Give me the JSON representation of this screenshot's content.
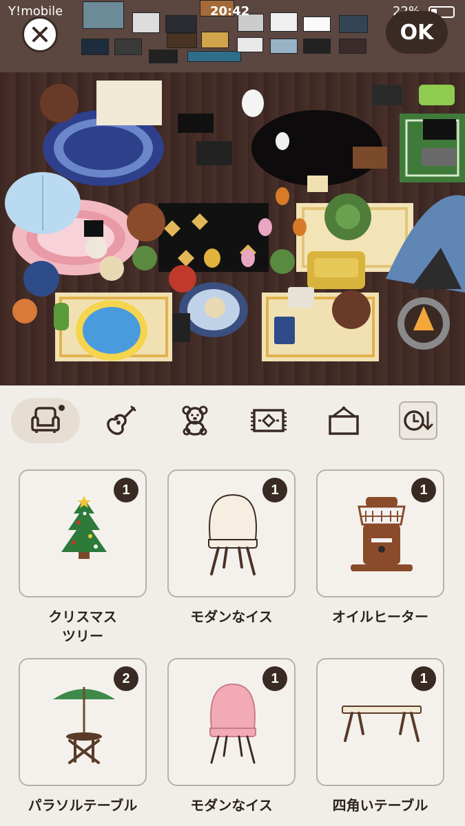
{
  "status_bar": {
    "carrier": "Y!mobile",
    "time": "20:42",
    "battery": "22%"
  },
  "header": {
    "ok_label": "OK"
  },
  "tabs": [
    {
      "name": "furniture",
      "icon": "armchair-icon",
      "active": true,
      "has_dot": true
    },
    {
      "name": "instruments",
      "icon": "guitar-icon"
    },
    {
      "name": "toys",
      "icon": "teddy-bear-icon"
    },
    {
      "name": "rugs",
      "icon": "rug-icon"
    },
    {
      "name": "wall",
      "icon": "wall-hanging-icon"
    },
    {
      "name": "sort",
      "icon": "clock-sort-icon"
    }
  ],
  "items": [
    {
      "name": "クリスマス\nツリー",
      "count": "1",
      "icon": "christmas-tree-icon"
    },
    {
      "name": "モダンなイス",
      "count": "1",
      "icon": "modern-chair-cream-icon"
    },
    {
      "name": "オイルヒーター",
      "count": "1",
      "icon": "oil-heater-icon"
    },
    {
      "name": "パラソルテーブル",
      "count": "2",
      "icon": "parasol-table-icon"
    },
    {
      "name": "モダンなイス",
      "count": "1",
      "icon": "modern-chair-pink-icon"
    },
    {
      "name": "四角いテーブル",
      "count": "1",
      "icon": "square-table-icon"
    }
  ],
  "colors": {
    "accent_dark": "#3a2a24",
    "panel_bg": "#f1eeea",
    "card_border": "#b9b0a8"
  }
}
